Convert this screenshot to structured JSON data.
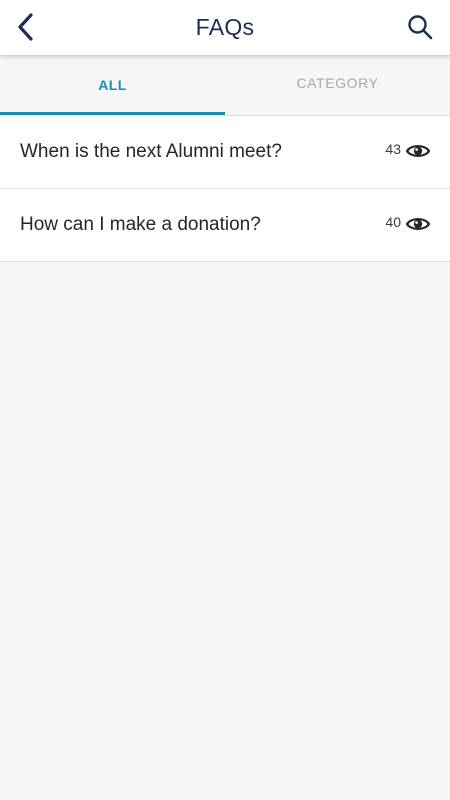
{
  "header": {
    "title": "FAQs",
    "back_icon": "chevron-left-icon",
    "search_icon": "search-icon"
  },
  "tabs": [
    {
      "label": "ALL",
      "active": true
    },
    {
      "label": "CATEGORY",
      "active": false
    }
  ],
  "faqs": [
    {
      "question": "When is the next Alumni meet?",
      "views": "43",
      "icon": "eye-icon"
    },
    {
      "question": "How can I make a donation?",
      "views": "40",
      "icon": "eye-icon"
    }
  ],
  "colors": {
    "accent": "#1d8ab2",
    "title": "#1b2d52",
    "background": "#f6f6f6"
  }
}
